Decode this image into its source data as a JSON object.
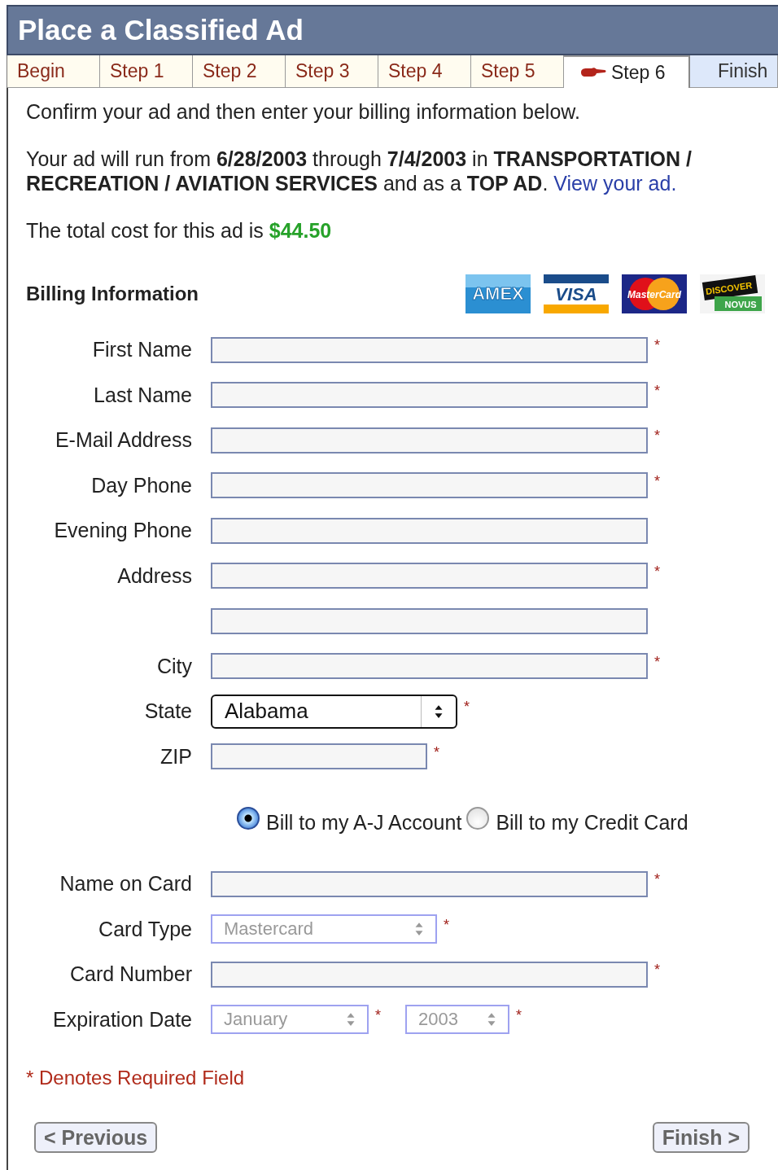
{
  "title": "Place a Classified Ad",
  "tabs": [
    {
      "label": "Begin",
      "selected": false,
      "kind": "done"
    },
    {
      "label": "Step 1",
      "selected": false,
      "kind": "done"
    },
    {
      "label": "Step 2",
      "selected": false,
      "kind": "done"
    },
    {
      "label": "Step 3",
      "selected": false,
      "kind": "done"
    },
    {
      "label": "Step 4",
      "selected": false,
      "kind": "done"
    },
    {
      "label": "Step 5",
      "selected": false,
      "kind": "done"
    },
    {
      "label": "Step 6",
      "selected": true,
      "kind": "current"
    },
    {
      "label": "Finish",
      "selected": false,
      "kind": "upcoming"
    }
  ],
  "intro": "Confirm your ad and then enter your billing information below.",
  "summary": {
    "text": "Your ad will run from **6/28/2003** through **7/4/2003** in **TRANSPORTATION / RECREATION / AVIATION SERVICES** and as a **TOP AD**.",
    "link": "View your ad."
  },
  "total": {
    "text": "The total cost for this ad is",
    "amount": "$44.50"
  },
  "billing": {
    "heading": "Billing Information",
    "cards": [
      {
        "kind": "amex",
        "label": "AMEX"
      },
      {
        "kind": "visa",
        "label": "VISA"
      },
      {
        "kind": "mastercard",
        "label": "MasterCard"
      },
      {
        "kind": "discover",
        "label": "DISCOVER",
        "sublabel": "NOVUS"
      }
    ]
  },
  "fields": [
    {
      "label": "First Name",
      "kind": "text",
      "required_mark": "*"
    },
    {
      "label": "Last Name",
      "kind": "text",
      "required_mark": "*"
    },
    {
      "label": "E-Mail Address",
      "kind": "text",
      "required_mark": "*"
    },
    {
      "label": "Day Phone",
      "kind": "text",
      "required_mark": "*"
    },
    {
      "label": "Evening Phone",
      "kind": "text"
    },
    {
      "label": "Address",
      "kind": "text",
      "required_mark": "*"
    },
    {
      "kind": "text"
    },
    {
      "label": "City",
      "kind": "text",
      "required_mark": "*"
    },
    {
      "label": "State",
      "kind": "select",
      "value": "Alabama",
      "disabled": false,
      "required_mark": "*"
    },
    {
      "label": "ZIP",
      "kind": "short",
      "required_mark": "*"
    }
  ],
  "billing_options": [
    {
      "label": "Bill to my A-J Account",
      "selected": true
    },
    {
      "label": "Bill to my Credit Card",
      "selected": false
    }
  ],
  "card_fields": [
    {
      "label": "Name on Card",
      "kind": "text",
      "required_mark": "*"
    },
    {
      "label": "Card Type",
      "kind": "select",
      "value": "Mastercard",
      "disabled": true,
      "required_mark": "*"
    },
    {
      "label": "Card Number",
      "kind": "text",
      "required_mark": "*"
    },
    {
      "label": "Expiration Date",
      "kind": "date",
      "parts": [
        {
          "value": "January",
          "disabled": true,
          "required_mark": "*"
        },
        {
          "value": "2003",
          "disabled": true,
          "required_mark": "*"
        }
      ]
    }
  ],
  "required_note": "* Denotes Required Field",
  "buttons": [
    {
      "label": "< Previous"
    },
    {
      "label": "Finish >"
    }
  ]
}
